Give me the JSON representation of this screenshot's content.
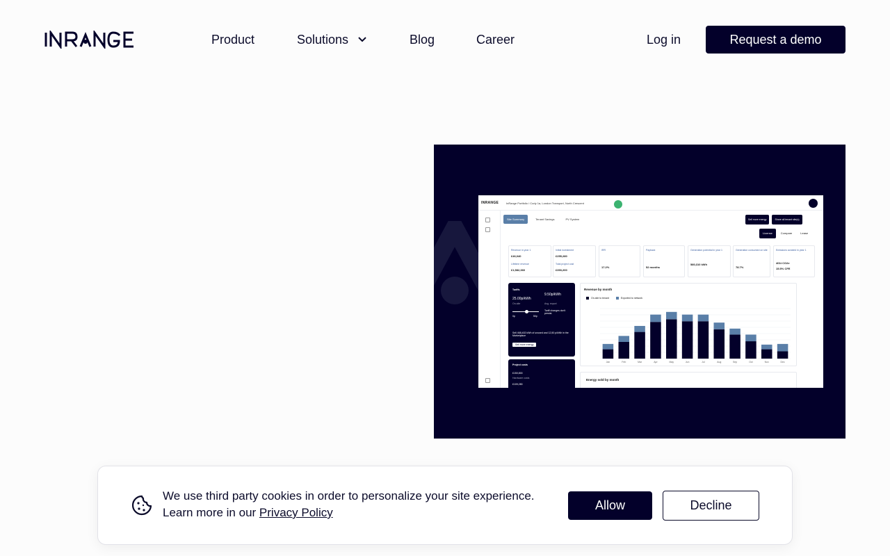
{
  "brand": {
    "logo_text": "INRANGE",
    "primary_color": "#03002a"
  },
  "nav": {
    "items": [
      {
        "label": "Product"
      },
      {
        "label": "Solutions",
        "icon": "chevron-down-icon"
      },
      {
        "label": "Blog"
      },
      {
        "label": "Career"
      }
    ],
    "login_label": "Log in",
    "cta_label": "Request a demo"
  },
  "hero": {
    "screenshot": {
      "logo": "INRANGE",
      "breadcrumb": "InRange Portfolio / Cody 1a, London Transport, North Crescent",
      "tabs": [
        "Site Summary",
        "Tenant Savings",
        "PV System"
      ],
      "actions": [
        "Sell more energy",
        "Share all tenant site(s)"
      ],
      "modes": [
        "License",
        "Compare",
        "Lease"
      ],
      "kpis": [
        {
          "label": "Revenue in year 1",
          "value": "£46,040",
          "label2": "Lifetime revenue",
          "value2": "£1,582,360"
        },
        {
          "label": "Initial investment",
          "value": "£255,280",
          "label2": "Total project cost",
          "value2": "£393,200"
        },
        {
          "label": "IRR",
          "value": "17.2%"
        },
        {
          "label": "Payback",
          "value": "52 months"
        },
        {
          "label": "Generation potential in year 1",
          "value": "580,310 kWh"
        },
        {
          "label": "Generation consumed on site",
          "value": "78.7%"
        },
        {
          "label": "Emissions avoided in year 1",
          "value": "401t CO2e",
          "value2": "15.5% CFE"
        }
      ],
      "tariffs": {
        "title": "Tariffs",
        "onsite_rate": "25.00p/kWh",
        "onsite_label": "On-site",
        "export_rate": "9.50p/kWh",
        "export_label": "Avg. export",
        "slider_min": "0p",
        "slider_max": "50p",
        "note": "Tariff changes don't persist.",
        "summary": "Sell 468,402 kWh of unused and 12,50 p/kWh in the Marketplace",
        "button": "Sell more energy"
      },
      "project_costs": {
        "title": "Project costs",
        "value": "£150,800",
        "sub": "Hardware costs",
        "value2": "£109,280"
      },
      "revenue_chart": {
        "title": "Revenue by month",
        "legend": [
          "On-site to tenant",
          "Exported to network"
        ],
        "months": [
          "Jan",
          "Feb",
          "Mar",
          "Apr",
          "May",
          "Jun",
          "Jul",
          "Aug",
          "Sep",
          "Oct",
          "Nov",
          "Dec"
        ],
        "onsite": [
          1400,
          2500,
          4000,
          5500,
          5900,
          5600,
          5600,
          4400,
          3600,
          2600,
          1400,
          1100
        ],
        "export": [
          800,
          900,
          900,
          1100,
          1100,
          1000,
          1000,
          1000,
          900,
          1000,
          700,
          1100
        ]
      },
      "energy_title": "Energy sold by month"
    }
  },
  "cookie": {
    "text": "We use third party cookies in order to personalize your site experience. Learn more in our",
    "link": "Privacy Policy",
    "allow": "Allow",
    "decline": "Decline",
    "icon": "cookie-icon"
  }
}
